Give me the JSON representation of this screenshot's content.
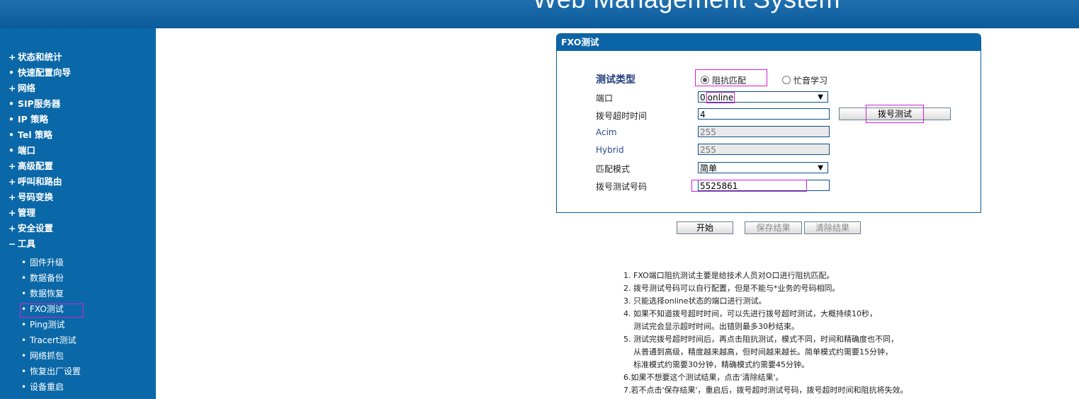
{
  "header": {
    "title": "Web Management System"
  },
  "sidebar": {
    "items": [
      {
        "mark": "+",
        "label": "状态和统计"
      },
      {
        "mark": "•",
        "label": "快速配置向导"
      },
      {
        "mark": "+",
        "label": "网络"
      },
      {
        "mark": "•",
        "label": "SIP服务器"
      },
      {
        "mark": "•",
        "label": "IP 策略"
      },
      {
        "mark": "•",
        "label": "Tel 策略"
      },
      {
        "mark": "•",
        "label": "端口"
      },
      {
        "mark": "+",
        "label": "高级配置"
      },
      {
        "mark": "+",
        "label": "呼叫和路由"
      },
      {
        "mark": "+",
        "label": "号码变换"
      },
      {
        "mark": "+",
        "label": "管理"
      },
      {
        "mark": "+",
        "label": "安全设置"
      },
      {
        "mark": "−",
        "label": "工具"
      }
    ],
    "sub_items": [
      {
        "mark": "•",
        "label": "固件升级"
      },
      {
        "mark": "•",
        "label": "数据备份"
      },
      {
        "mark": "•",
        "label": "数据恢复"
      },
      {
        "mark": "•",
        "label": "FXO测试"
      },
      {
        "mark": "•",
        "label": "Ping测试"
      },
      {
        "mark": "•",
        "label": "Tracert测试"
      },
      {
        "mark": "•",
        "label": "网络抓包"
      },
      {
        "mark": "•",
        "label": "恢复出厂设置"
      },
      {
        "mark": "•",
        "label": "设备重启"
      }
    ]
  },
  "panel": {
    "title": "FXO测试",
    "test_type_label": "测试类型",
    "radio_impedance": "阻抗匹配",
    "radio_busy": "忙音学习",
    "port_label": "端口",
    "port_value_num": "0",
    "port_value_status": "online",
    "timeout_label": "拨号超时时间",
    "timeout_value": "4",
    "dial_test_button": "拨号测试",
    "acim_label": "Acim",
    "acim_value": "255",
    "hybrid_label": "Hybrid",
    "hybrid_value": "255",
    "match_mode_label": "匹配模式",
    "match_mode_value": "简单",
    "dial_number_label": "拨号测试号码",
    "dial_number_value": "5525861"
  },
  "actions": {
    "start": "开始",
    "save": "保存结果",
    "clear": "清除结果"
  },
  "notes": [
    "1. FXO端口阻抗测试主要是给技术人员对O口进行阻抗匹配。",
    "2. 拨号测试号码可以自行配置，但是不能与*业务的号码相同。",
    "3. 只能选择online状态的端口进行测试。",
    "4. 如果不知道拨号超时时间，可以先进行拨号超时测试，大概持续10秒，",
    "    测试完会显示超时时间。出错则最多30秒结束。",
    "5. 测试完拨号超时时间后，再点击阻抗测试，模式不同，时间和精确度也不同，",
    "    从普通到高级，精度越来越高，但时间越来越长。简单模式约需要15分钟，",
    "    标准模式约需要30分钟，精确模式约需要45分钟。",
    "6.如果不想要这个测试结果，点击'清除结果'。",
    "7.若不点击'保存结果'，重启后，拨号超时测试号码，拨号超时时间和阻抗将失效。"
  ],
  "colors": {
    "brand": "#0a68a8",
    "highlight": "#d41fd6"
  }
}
